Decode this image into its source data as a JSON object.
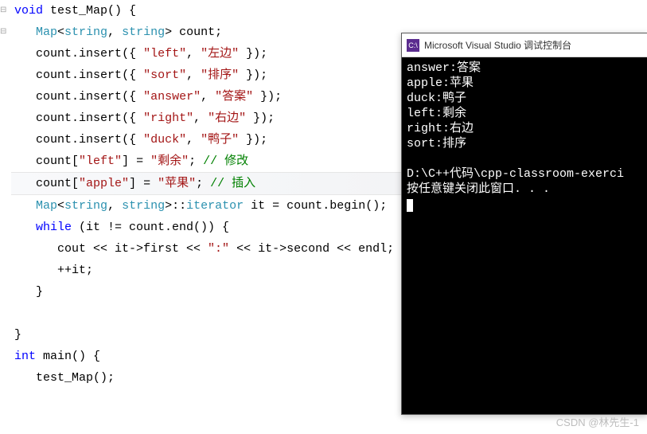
{
  "code": {
    "fn_decl": {
      "kw_void": "void",
      "name": "test_Map",
      "paren": "() {"
    },
    "decl_map": {
      "type": "Map",
      "tpl_open": "<",
      "str_t": "string",
      "comma": ", ",
      "close": ">",
      "var": " count",
      "semi": ";"
    },
    "ins1": {
      "obj": "count",
      "dot": ".",
      "m": "insert",
      "open": "({ ",
      "k": "\"left\"",
      "c": ", ",
      "v": "\"左边\"",
      "close": " });"
    },
    "ins2": {
      "obj": "count",
      "dot": ".",
      "m": "insert",
      "open": "({ ",
      "k": "\"sort\"",
      "c": ", ",
      "v": "\"排序\"",
      "close": " });"
    },
    "ins3": {
      "obj": "count",
      "dot": ".",
      "m": "insert",
      "open": "({ ",
      "k": "\"answer\"",
      "c": ", ",
      "v": "\"答案\"",
      "close": " });"
    },
    "ins4": {
      "obj": "count",
      "dot": ".",
      "m": "insert",
      "open": "({ ",
      "k": "\"right\"",
      "c": ", ",
      "v": "\"右边\"",
      "close": " });"
    },
    "ins5": {
      "obj": "count",
      "dot": ".",
      "m": "insert",
      "open": "({ ",
      "k": "\"duck\"",
      "c": ", ",
      "v": "\"鸭子\"",
      "close": " });"
    },
    "set1": {
      "obj": "count",
      "br_open": "[",
      "k": "\"left\"",
      "br_close": "]",
      " eq": " = ",
      "v": "\"剩余\"",
      "semi": "; ",
      "cmt": "// 修改"
    },
    "set2": {
      "obj": "count",
      "br_open": "[",
      "k": "\"apple\"",
      "br_close": "]",
      " eq": " = ",
      "v": "\"苹果\"",
      "semi": "; ",
      "cmt": "// 插入"
    },
    "iter": {
      "type": "Map",
      "tpl_open": "<",
      "str_t": "string",
      "comma": ", ",
      "close": ">",
      "cc": "::",
      "itype": "iterator",
      "var": " it",
      " eq": " = ",
      "obj": "count",
      "dot": ".",
      "m": "begin",
      "paren": "();"
    },
    "while": {
      "kw": "while",
      "txt": " (it != count.end()) {"
    },
    "cout": {
      "txt1": "cout << it->first << ",
      "colon": "\":\"",
      "txt2": " << it->second << endl;"
    },
    "inc": "++it;",
    "brace_close": "}",
    "main_decl": {
      "kw_int": "int",
      "name": " main",
      "paren": "() {"
    },
    "call": "test_Map();"
  },
  "console": {
    "title": "Microsoft Visual Studio 调试控制台",
    "icon": "C:\\",
    "lines": [
      "answer:答案",
      "apple:苹果",
      "duck:鸭子",
      "left:剩余",
      "right:右边",
      "sort:排序"
    ],
    "path": "D:\\C++代码\\cpp-classroom-exerci",
    "prompt": "按任意键关闭此窗口. . ."
  },
  "watermark": "CSDN @林先生-1"
}
